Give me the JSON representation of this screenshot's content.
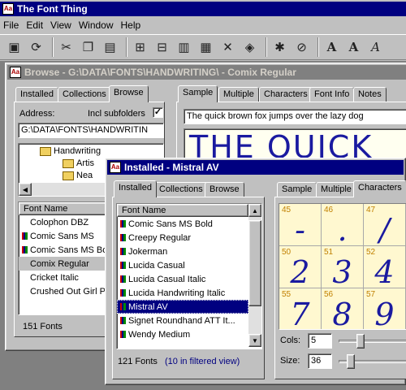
{
  "app": {
    "title": "The Font Thing",
    "menu": [
      "File",
      "Edit",
      "View",
      "Window",
      "Help"
    ],
    "toolbar_icons": [
      "new-window-icon",
      "refresh-icon",
      "cut-icon",
      "copy-icon",
      "paste-icon",
      "install-icon",
      "uninstall-icon",
      "print-icon",
      "properties-icon",
      "delete-icon",
      "book-icon",
      "asterisk-icon",
      "stop-icon",
      "font-a-icon",
      "font-a-bold-icon",
      "font-a-italic-icon"
    ]
  },
  "browse_window": {
    "title": "Browse - G:\\DATA\\FONTS\\HANDWRITING\\ - Comix Regular",
    "left_tabs": [
      "Installed",
      "Collections",
      "Browse"
    ],
    "active_left_tab": "Browse",
    "address_label": "Address:",
    "incl_subfolders_label": "Incl subfolders",
    "incl_subfolders_checked": true,
    "address_value": "G:\\DATA\\FONTS\\HANDWRITIN",
    "folders": [
      {
        "label": "Handwriting",
        "level": 1
      },
      {
        "label": "Artis",
        "level": 2
      },
      {
        "label": "Nea",
        "level": 2
      }
    ],
    "font_list_header": "Font Name",
    "fonts": [
      {
        "name": "Colophon DBZ",
        "icon": false,
        "selected": false
      },
      {
        "name": "Comic Sans MS",
        "icon": true,
        "selected": false
      },
      {
        "name": "Comic Sans MS Bo",
        "icon": true,
        "selected": false
      },
      {
        "name": "Comix Regular",
        "icon": false,
        "selected": true
      },
      {
        "name": "Cricket Italic",
        "icon": false,
        "selected": false
      },
      {
        "name": "Crushed Out Girl P",
        "icon": false,
        "selected": false
      }
    ],
    "status": "151 Fonts",
    "right_tabs": [
      "Sample",
      "Multiple",
      "Characters",
      "Font Info",
      "Notes"
    ],
    "active_right_tab": "Sample",
    "sample_text": "The quick brown fox jumps over the lazy dog",
    "sample_preview": "THE QUICK"
  },
  "installed_window": {
    "title": "Installed - Mistral AV",
    "left_tabs": [
      "Installed",
      "Collections",
      "Browse"
    ],
    "active_left_tab": "Installed",
    "font_list_header": "Font Name",
    "fonts": [
      {
        "name": "Comic Sans MS Bold",
        "selected": false
      },
      {
        "name": "Creepy Regular",
        "selected": false
      },
      {
        "name": "Jokerman",
        "selected": false
      },
      {
        "name": "Lucida Casual",
        "selected": false
      },
      {
        "name": "Lucida Casual Italic",
        "selected": false
      },
      {
        "name": "Lucida Handwriting Italic",
        "selected": false
      },
      {
        "name": "Mistral AV",
        "selected": true
      },
      {
        "name": "Signet Roundhand ATT It...",
        "selected": false
      },
      {
        "name": "Wendy Medium",
        "selected": false
      }
    ],
    "status_count": "121 Fonts",
    "status_filter": "(10 in filtered view)",
    "right_tabs": [
      "Sample",
      "Multiple",
      "Characters"
    ],
    "active_right_tab": "Characters",
    "characters": [
      {
        "code": "45",
        "glyph": "-"
      },
      {
        "code": "46",
        "glyph": "."
      },
      {
        "code": "47",
        "glyph": "/"
      },
      {
        "code": "50",
        "glyph": "2"
      },
      {
        "code": "51",
        "glyph": "3"
      },
      {
        "code": "52",
        "glyph": "4"
      },
      {
        "code": "55",
        "glyph": "7"
      },
      {
        "code": "56",
        "glyph": "8"
      },
      {
        "code": "57",
        "glyph": "9"
      }
    ],
    "cols_label": "Cols:",
    "cols_value": "5",
    "size_label": "Size:",
    "size_value": "36"
  },
  "colors": {
    "active_title": "#000080",
    "inactive_title": "#808080",
    "selection": "#000080",
    "preview_ink": "#1a1aa0",
    "status_filter_text": "#000080"
  }
}
